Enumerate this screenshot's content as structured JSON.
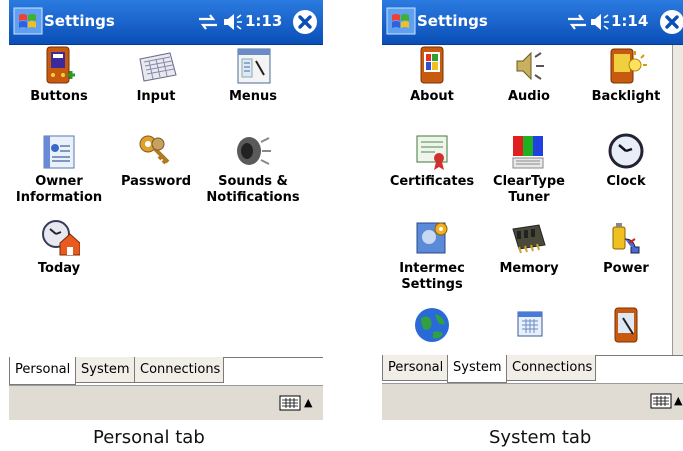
{
  "screens": [
    {
      "title": "Settings",
      "time": "1:13",
      "items": [
        {
          "label": "Buttons",
          "icon": "buttons-icon"
        },
        {
          "label": "Input",
          "icon": "keyboard-icon"
        },
        {
          "label": "Menus",
          "icon": "menus-icon"
        },
        {
          "label": "Owner\nInformation",
          "icon": "owner-information-icon"
        },
        {
          "label": "Password",
          "icon": "keys-icon"
        },
        {
          "label": "Sounds &\nNotifications",
          "icon": "speaker-icon"
        },
        {
          "label": "Today",
          "icon": "today-icon"
        }
      ],
      "tabs": [
        "Personal",
        "System",
        "Connections"
      ],
      "active_tab": "Personal",
      "caption": "Personal tab"
    },
    {
      "title": "Settings",
      "time": "1:14",
      "items": [
        {
          "label": "About",
          "icon": "about-icon"
        },
        {
          "label": "Audio",
          "icon": "audio-icon"
        },
        {
          "label": "Backlight",
          "icon": "backlight-icon"
        },
        {
          "label": "Certificates",
          "icon": "certificate-icon"
        },
        {
          "label": "ClearType\nTuner",
          "icon": "cleartype-icon"
        },
        {
          "label": "Clock",
          "icon": "clock-icon"
        },
        {
          "label": "Intermec\nSettings",
          "icon": "intermec-settings-icon"
        },
        {
          "label": "Memory",
          "icon": "memory-icon"
        },
        {
          "label": "Power",
          "icon": "power-icon"
        },
        {
          "label": "",
          "icon": "globe-icon"
        },
        {
          "label": "",
          "icon": "calendar-icon"
        },
        {
          "label": "",
          "icon": "pda-icon"
        }
      ],
      "tabs": [
        "Personal",
        "System",
        "Connections"
      ],
      "active_tab": "System",
      "caption": "System tab"
    }
  ]
}
